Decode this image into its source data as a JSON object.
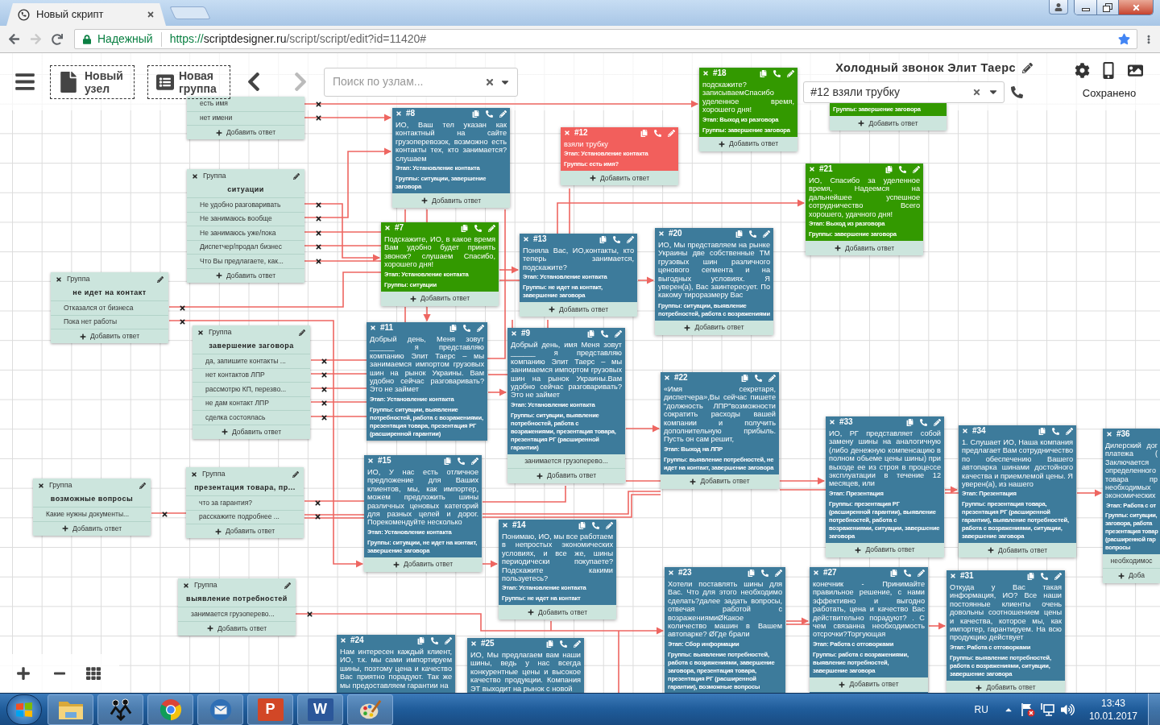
{
  "browser": {
    "tab": {
      "title": "Новый скрипт"
    },
    "back_enabled": true,
    "forward_enabled": false,
    "address": {
      "security": "Надежный",
      "scheme": "https://",
      "host": "scriptdesigner.ru",
      "path": "/script/script/edit?id=11420#"
    },
    "bookmarked": true
  },
  "toolbar": {
    "new_node": "Новый узел",
    "new_group": "Новая группа",
    "undo_enabled": true,
    "redo_enabled": false,
    "search": {
      "placeholder": "Поиск по узлам..."
    },
    "script_title": "Холодный звонок Элит Таерс",
    "current_node": {
      "value": "#12 взяли трубку"
    },
    "save_status": "Сохранено"
  },
  "diagram": {
    "columns": [
      {
        "items": [
          {
            "kind": "group",
            "label": "Группа",
            "title": "не идет на контакт",
            "answers": [
              "Отказался от бизнеса",
              "Пока нет работы"
            ],
            "add_answer": "Добавить ответ"
          },
          {
            "kind": "group",
            "label": "Группа",
            "title": "возможные вопросы",
            "answers": [
              "Какие нужны документы..."
            ],
            "add_answer": "Добавить ответ"
          }
        ]
      },
      {
        "items": [
          {
            "kind": "group",
            "answers": [
              "есть имя",
              "нет имени"
            ],
            "add_answer": "Добавить ответ"
          },
          {
            "kind": "group",
            "label": "Группа",
            "title": "ситуации",
            "answers": [
              "Не удобно разговаривать",
              "Не занимаюсь вообще",
              "Не занимаюсь уже/пока",
              "Диспетчер/продал бизнес",
              "Что Вы предлагаете, как..."
            ],
            "add_answer": "Добавить ответ"
          },
          {
            "kind": "group",
            "label": "Группа",
            "title": "завершение заговора",
            "answers": [
              "да, запишите контакты ...",
              "нет контактов ЛПР",
              "рассмотрю КП, перезво...",
              "не дам контакт ЛПР",
              "сделка состоялась"
            ],
            "add_answer": "Добавить ответ"
          },
          {
            "kind": "group",
            "label": "Группа",
            "title": "презентация товара, пр...",
            "answers": [
              "что за гарантия?",
              "расскажите подробнее ..."
            ],
            "add_answer": "Добавить ответ"
          },
          {
            "kind": "group",
            "label": "Группа",
            "title": "выявление потребностей",
            "answers": [
              "занимается грузоперево..."
            ],
            "add_answer": "Добавить ответ"
          }
        ]
      },
      {
        "items": [
          {
            "kind": "step",
            "number": "#8",
            "color": "#3d7b9b",
            "text": "ИО, Ваш тел указан как контактный на сайте грузоперевозок, возможно есть контакты тех, кто занимается? слушаем",
            "stage": "Этап: Установление контакта",
            "groups": "Группы: ситуации, завершение заговора",
            "add_answer": "Добавить ответ"
          },
          {
            "kind": "step",
            "number": "#7",
            "color": "#339900",
            "text": "Подскажите, ИО, в какое время Вам удобно будет принять звонок? слушаем Спасибо, хорошего дня!",
            "stage": "Этап: Установление контакта",
            "groups": "Группы: ситуации",
            "add_answer": "Добавить ответ"
          },
          {
            "kind": "step",
            "number": "#11",
            "color": "#3d7b9b",
            "text": "Добрый день, Меня зовут ______ я представляю компанию Элит Таерс – мы занимаемся импортом грузовых шин на рынок Украины. Вам удобно сейчас разговаривать? Это не займет",
            "stage": "Этап: Установление контакта",
            "groups": "Группы: ситуации, выявление потребностей, работа с возражениями, презентация товара, презентация РГ (расширенной гарантии)"
          },
          {
            "kind": "step",
            "number": "#15",
            "color": "#3d7b9b",
            "text": "ИО, У нас есть отличное предложение для Ваших клиентов, мы, как импортер, можем предложить шины различных ценовых категорий для разных целей и дорог. Порекомендуйте несколько",
            "stage": "Этап: Установление контакта",
            "groups": "Группы: ситуации, не идет на контакт, завершение заговора",
            "add_answer": "Добавить ответ"
          },
          {
            "kind": "step",
            "number": "#24",
            "color": "#3d7b9b",
            "text": "Нам интересен каждый клиент, ИО, т.к. мы сами импортируем шины, поэтому цена и качество Вас приятно порадуют. Так же мы предоставляем гарантии на"
          }
        ]
      },
      {
        "items": [
          {
            "kind": "step",
            "number": "#12",
            "color": "#f25f5c",
            "text": "взяли трубку",
            "stage": "Этап: Установление контакта",
            "groups": "Группы: есть имя?",
            "add_answer": "Добавить ответ"
          },
          {
            "kind": "step",
            "number": "#13",
            "color": "#3d7b9b",
            "text": "Поняла Вас, ИО,контакты, кто теперь занимается, подскажите?",
            "stage": "Этап: Установление контакта",
            "groups": "Группы: не идет на контакт, завершение заговора",
            "add_answer": "Добавить ответ"
          },
          {
            "kind": "step",
            "number": "#9",
            "color": "#3d7b9b",
            "text": "Добрый день, имя Меня зовут ______ я представляю компанию Элит Таерс – мы занимаемся импортом грузовых шин на рынок Украины.Вам удобно сейчас разговаривать? Это не займет",
            "stage": "Этап: Установление контакта",
            "groups": "Группы: ситуации, выявление потребностей, работа с возражениями, презентация товара, презентация РГ (расширенной гарантии)",
            "answers": [
              "занимается грузоперево..."
            ],
            "add_answer": "Добавить ответ"
          },
          {
            "kind": "step",
            "number": "#14",
            "color": "#3d7b9b",
            "text": "Понимаю, ИО, мы все работаем в непростых экономических условиях, и все же, шины периодически покупаете? Подскажите какими пользуетесь?",
            "stage": "Этап: Установление контакта",
            "groups": "Группы: не идет на контакт",
            "add_answer": "Добавить ответ"
          },
          {
            "kind": "step",
            "number": "#25",
            "color": "#3d7b9b",
            "text": "ИО, Мы предлагаем вам наши шины, ведь у нас всегда конкурентные цены и высокое качество продукции. Компания ЭТ выходит на рынок с новой"
          }
        ]
      },
      {
        "items": [
          {
            "kind": "step",
            "number": "#18",
            "color": "#339900",
            "text": "подскажите? записываемСпасибо уделенное время, хорошего дня!",
            "stage": "Этап: Выход из разговора",
            "groups": "Группы: завершение заговора",
            "add_answer": "Добавить ответ"
          },
          {
            "kind": "step",
            "number": "#20",
            "color": "#3d7b9b",
            "text": "ИО, Мы представляем на рынке Украины две собственные ТМ грузовых шин различного ценового сегмента и на выгодных условиях. Я уверен(а), Вас заинтересует. По какому тироразмеру Вас",
            "groups": "Группы: ситуации, выявление потребностей, работа с возражениями",
            "add_answer": "Добавить ответ"
          },
          {
            "kind": "step",
            "number": "#22",
            "color": "#3d7b9b",
            "text": "«Имя секретаря, диспетчера»,Вы сейчас пишете \"должность ЛПР\"возможности сократить расходы вашей компании и получить дополнительную прибыль. Пусть он сам решит,",
            "stage": "Этап: Выход на ЛПР",
            "groups": "Группы: выявление потребностей, не идет на контакт, завершение заговора",
            "add_answer": "Добавить ответ"
          },
          {
            "kind": "step",
            "number": "#23",
            "color": "#3d7b9b",
            "text": "Хотели поставлять шины для Вас. Что для этого необходимо сделать?далее задать вопросы, отвечая работой с возражениямиØКакое количество машин в Вашем автопарке? ØГде брали",
            "stage": "Этап: Сбор информации",
            "groups": "Группы: выявление потребностей, работа с возражениями, завершение заговора, презентация товара, презентация РГ (расширенной гарантии), возможные вопросы"
          }
        ]
      },
      {
        "items": [
          {
            "kind": "step",
            "color": "#339900",
            "groups": "Группы: завершение заговора",
            "add_answer": "Добавить ответ"
          },
          {
            "kind": "step",
            "number": "#21",
            "color": "#339900",
            "text": "ИО, Спасибо за уделенное время, Надеемся на дальнейшее успешное сотрудничество Всего хорошего, удачного дня!",
            "stage": "Этап: Выход из разговора",
            "groups": "Группы: завершение заговора",
            "add_answer": "Добавить ответ"
          },
          {
            "kind": "step",
            "number": "#33",
            "color": "#3d7b9b",
            "text": "ИО, РГ представляет собой замену шины на аналогичную (либо денежную компенсацию в полном обьеме цены шины) при выходе ее из строя в процессе эксплуатации в течение 12 месяцев, или",
            "stage": "Этап: Презентация",
            "groups": "Группы: презентация РГ (расширенной гарантии), выявление потребностей, работа с возражениями, ситуации, завершение заговора",
            "add_answer": "Добавить ответ"
          },
          {
            "kind": "step",
            "number": "#27",
            "color": "#3d7b9b",
            "text": "конечник - Принимайте правильное решение, с нами эффективно и выгодно работать, цена и качество Вас действительно порадуют? . С чем связанна необходимость отсрочки?Торгующая",
            "stage": "Этап: Работа с отговорками",
            "groups": "Группы: работа с возражениями, выявление потребностей, завершение заговора",
            "add_answer": "Добавить ответ"
          }
        ]
      },
      {
        "items": [
          {
            "kind": "step",
            "number": "#34",
            "color": "#3d7b9b",
            "text": "1. Слушает ИО, Наша компания предлагает Вам сотрудничество по обеспечению Вашего автопарка шинами достойного качества и приемлемой цены. Я уверен(а), из нашего",
            "stage": "Этап: Презентация",
            "groups": "Группы: презентация товара, презентация РГ (расширенной гарантии), выявление потребностей, работа с возражениями, ситуации, завершение заговора",
            "add_answer": "Добавить ответ"
          },
          {
            "kind": "step",
            "number": "#31",
            "color": "#3d7b9b",
            "text": "Откуда у Вас такая информация, ИО? Все наши постоянные клиенты очень довольны соотношением цены и качества, которое мы, как импортер, гарантируем. На всю продукцию действует",
            "stage": "Этап: Работа с отговорками",
            "groups": "Группы: выявление потребностей, работа с возражениями, ситуации, завершение заговора",
            "add_answer": "Добавить ответ"
          }
        ]
      },
      {
        "items": [
          {
            "kind": "step",
            "number": "#36",
            "color": "#3d7b9b",
            "text_lines": [
              "Дилерский дог",
              "платежа (",
              "Заключается",
              "определенного",
              "товара пр",
              "необходимых",
              "экономических"
            ],
            "stage": "Этап: Работа с от",
            "groups_lines": [
              "Группы: ситуации,",
              "заговора, работа",
              "презентация товар",
              "(расширенной гар",
              "вопросы"
            ],
            "answers": [
              "необходимос"
            ],
            "add_answer": "Доба"
          }
        ]
      }
    ]
  },
  "taskbar": {
    "apps": [
      {
        "kind": "folder"
      },
      {
        "kind": "people"
      },
      {
        "kind": "chrome"
      },
      {
        "kind": "mail"
      },
      {
        "kind": "slides",
        "letter": "P"
      },
      {
        "kind": "doc",
        "letter": "W"
      },
      {
        "kind": "paint"
      }
    ],
    "language": "RU",
    "time": "13:43",
    "date": "10.01.2017"
  }
}
